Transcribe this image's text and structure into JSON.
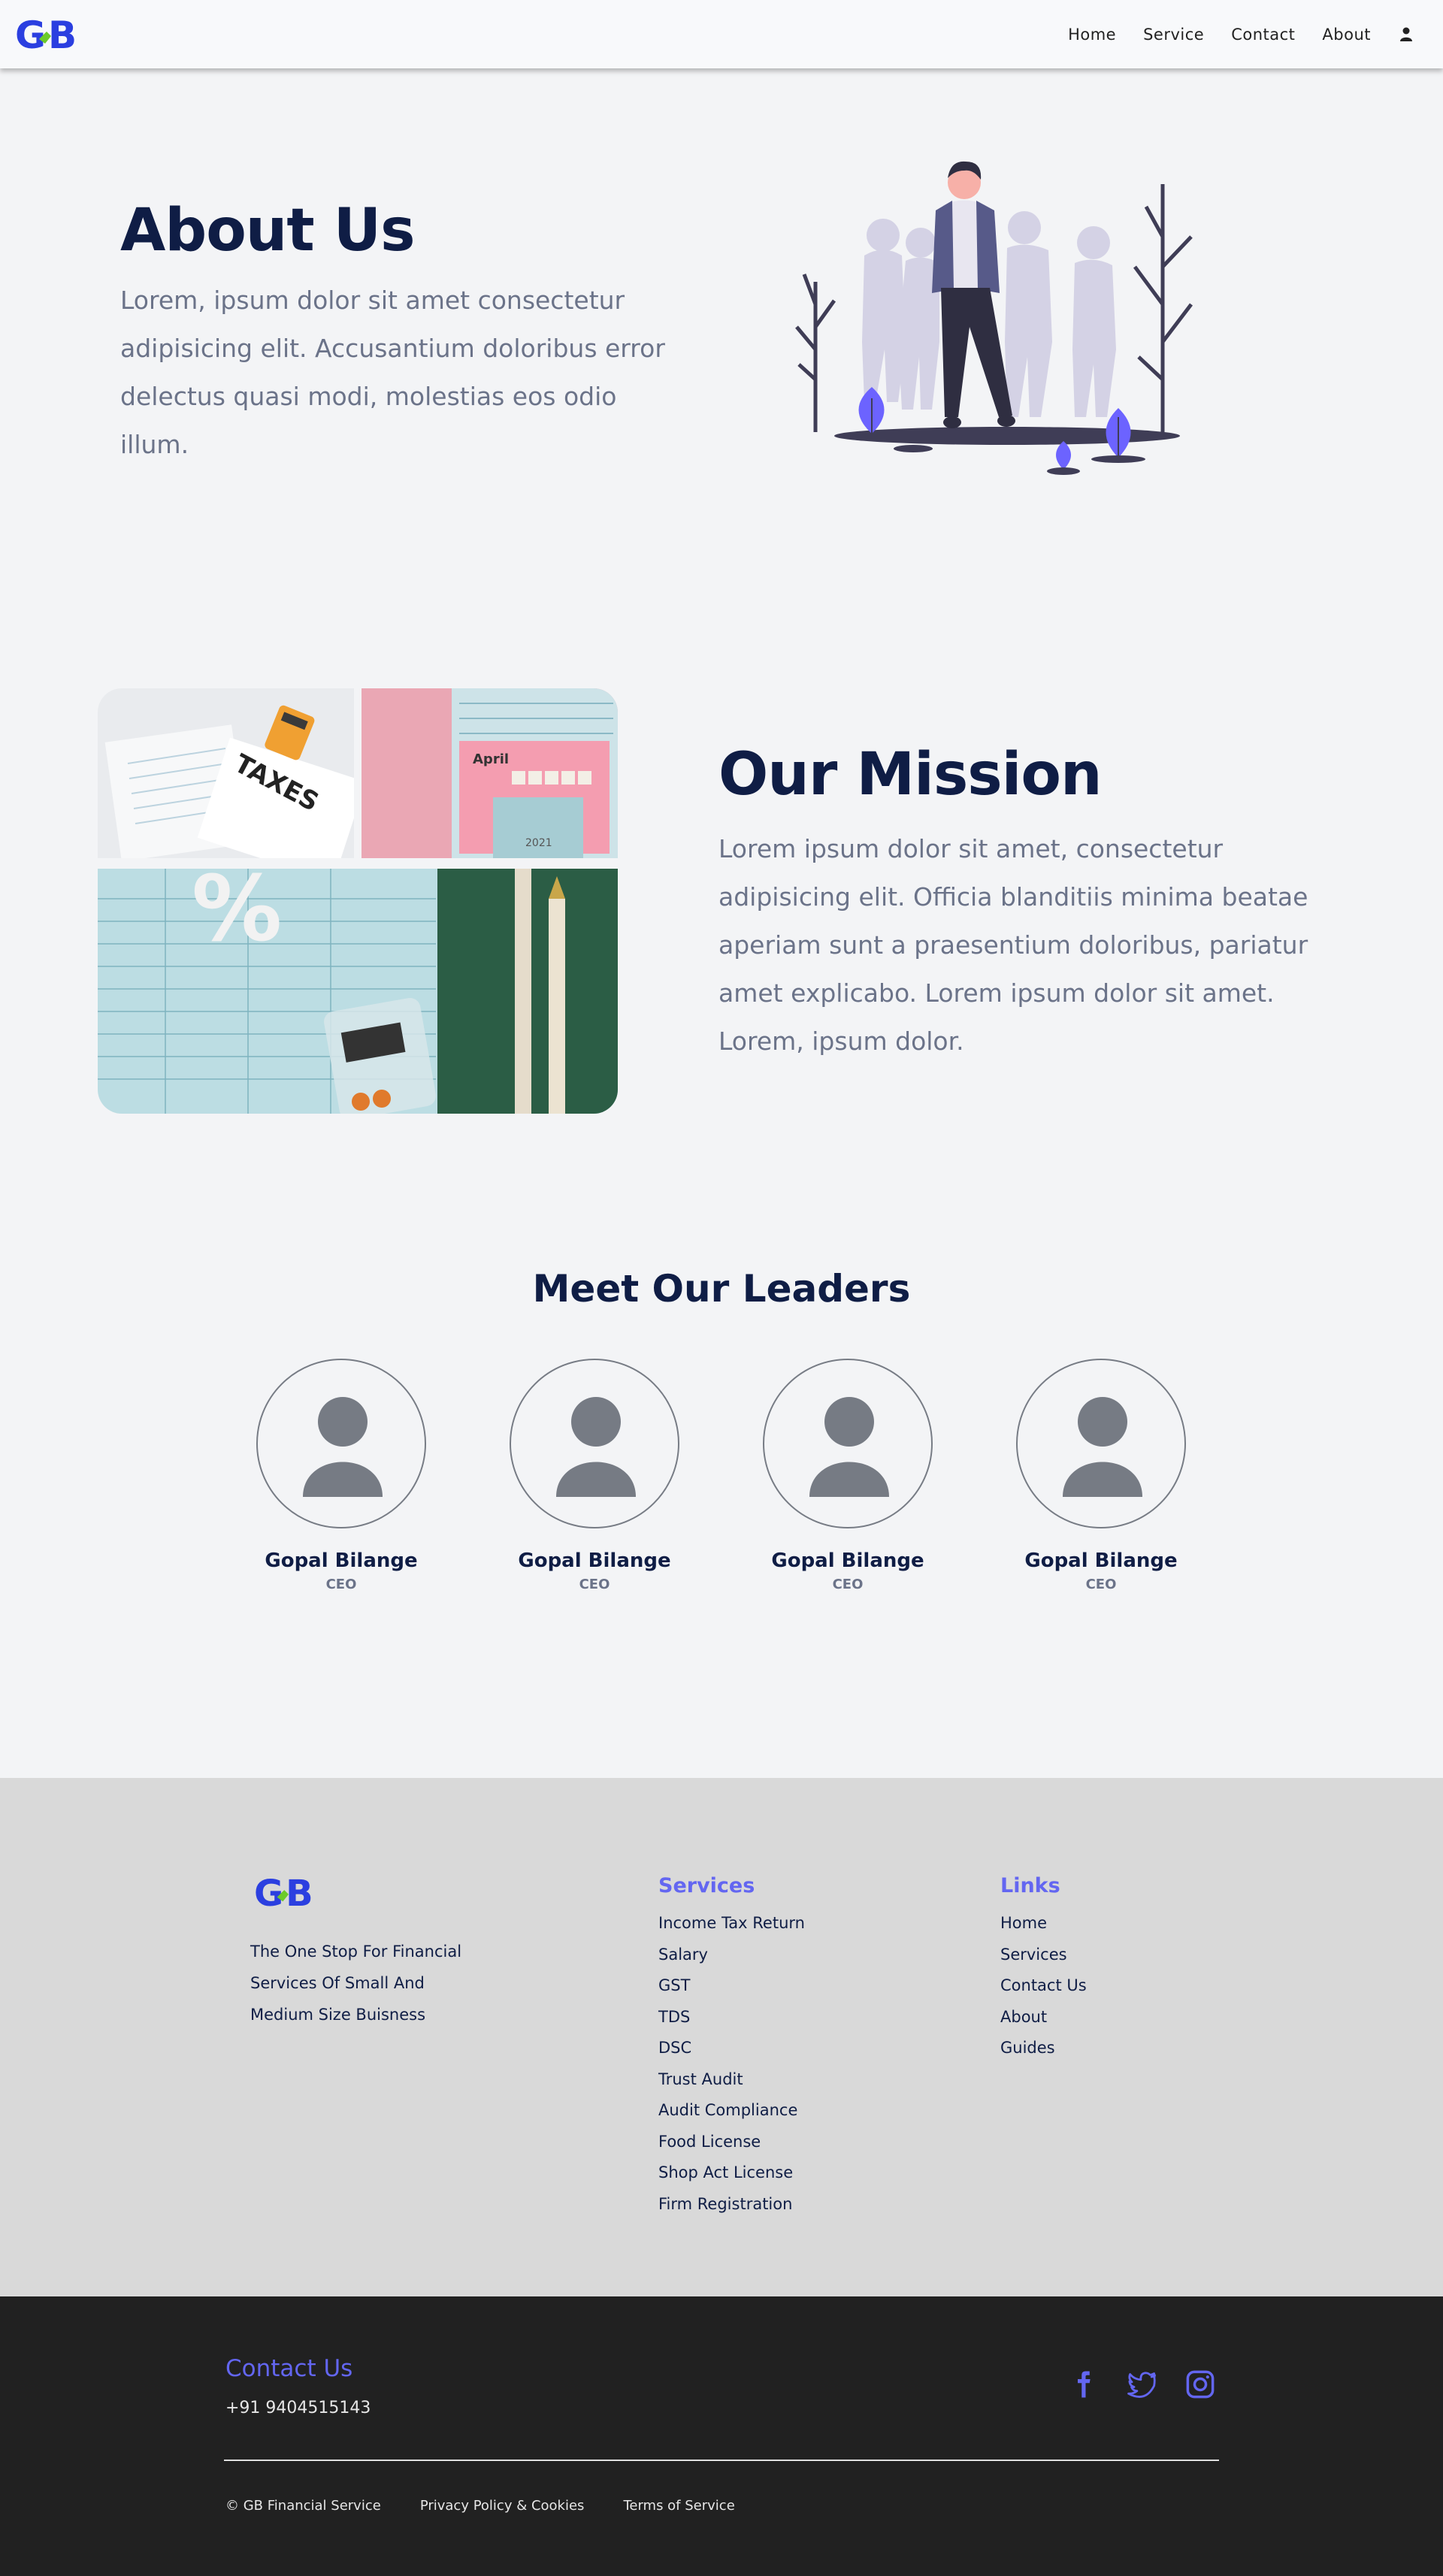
{
  "brand": {
    "logo_text": "GB"
  },
  "nav": {
    "items": [
      {
        "label": "Home"
      },
      {
        "label": "Service"
      },
      {
        "label": "Contact"
      },
      {
        "label": "About"
      }
    ],
    "user_icon": "user-icon"
  },
  "about": {
    "title": "About Us",
    "text": "Lorem, ipsum dolor sit amet consectetur adipisicing elit. Accusantium doloribus error delectus quasi modi, molestias eos odio illum."
  },
  "mission": {
    "title": "Our Mission",
    "text": "Lorem ipsum dolor sit amet, consectetur adipisicing elit. Officia blanditiis minima beatae aperiam sunt a praesentium doloribus, pariatur amet explicabo. Lorem ipsum dolor sit amet. Lorem, ipsum dolor.",
    "photo_texts": {
      "taxes": "TAXES",
      "month": "April",
      "year": "2021",
      "percent": "%"
    }
  },
  "leaders": {
    "title": "Meet Our Leaders",
    "people": [
      {
        "name": "Gopal Bilange",
        "role": "CEO"
      },
      {
        "name": "Gopal Bilange",
        "role": "CEO"
      },
      {
        "name": "Gopal Bilange",
        "role": "CEO"
      },
      {
        "name": "Gopal Bilange",
        "role": "CEO"
      }
    ]
  },
  "footer": {
    "tagline": "The One Stop For Financial Services Of Small And Medium Size Buisness",
    "services_title": "Services",
    "services": [
      "Income Tax Return",
      "Salary",
      "GST",
      "TDS",
      "DSC",
      "Trust Audit",
      "Audit Compliance",
      "Food License",
      "Shop Act License",
      "Firm Registration"
    ],
    "links_title": "Links",
    "links": [
      "Home",
      "Services",
      "Contact Us",
      "About",
      "Guides"
    ],
    "contact_title": "Contact Us",
    "phone": "+91 9404515143",
    "socials": [
      "facebook-icon",
      "twitter-icon",
      "instagram-icon"
    ],
    "bottom_links": [
      "© GB Financial Service",
      "Privacy Policy & Cookies",
      "Terms of Service"
    ]
  },
  "colors": {
    "accent": "#6366f1",
    "logo_blue": "#2b3fe0",
    "logo_green": "#6ccb2a",
    "heading": "#0f1d45",
    "muted": "#6b7389",
    "page_bg": "#f3f4f6",
    "footer_light": "#d9d9d9",
    "footer_dark": "#212121"
  }
}
